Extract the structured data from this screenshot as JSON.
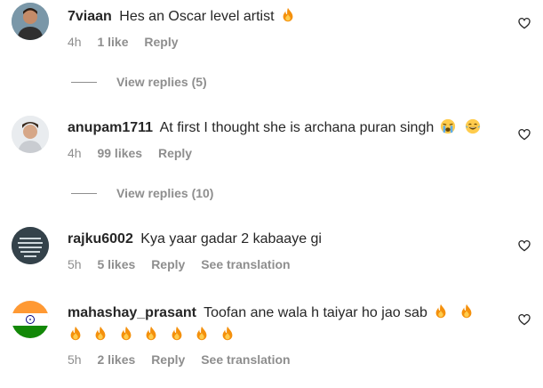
{
  "comments": [
    {
      "username": "7viaan",
      "text": "Hes an Oscar level artist",
      "emoji_after": [
        "fire"
      ],
      "time": "4h",
      "likes": "1 like",
      "reply": "Reply",
      "translation": "",
      "view_replies": "View replies (5)"
    },
    {
      "username": "anupam1711",
      "text": "At first I thought she is archana puran singh",
      "emoji_after": [
        "loudly-crying",
        "joy"
      ],
      "time": "4h",
      "likes": "99 likes",
      "reply": "Reply",
      "translation": "",
      "view_replies": "View replies (10)"
    },
    {
      "username": "rajku6002",
      "text": "Kya yaar gadar 2 kabaaye gi",
      "emoji_after": [],
      "time": "5h",
      "likes": "5 likes",
      "reply": "Reply",
      "translation": "See translation",
      "view_replies": ""
    },
    {
      "username": "mahashay_prasant",
      "text": "Toofan ane wala h taiyar ho jao sab",
      "emoji_after": [
        "fire",
        "fire"
      ],
      "emoji_line2": [
        "fire",
        "fire",
        "fire",
        "fire",
        "fire",
        "fire",
        "fire"
      ],
      "time": "5h",
      "likes": "2 likes",
      "reply": "Reply",
      "translation": "See translation",
      "view_replies": ""
    }
  ],
  "icons": {
    "like": "heart-outline-icon",
    "fire": "fire-emoji",
    "flag": "india-flag"
  },
  "colors": {
    "primary_text": "#262626",
    "secondary_text": "#8e8e8e",
    "background": "#ffffff"
  }
}
